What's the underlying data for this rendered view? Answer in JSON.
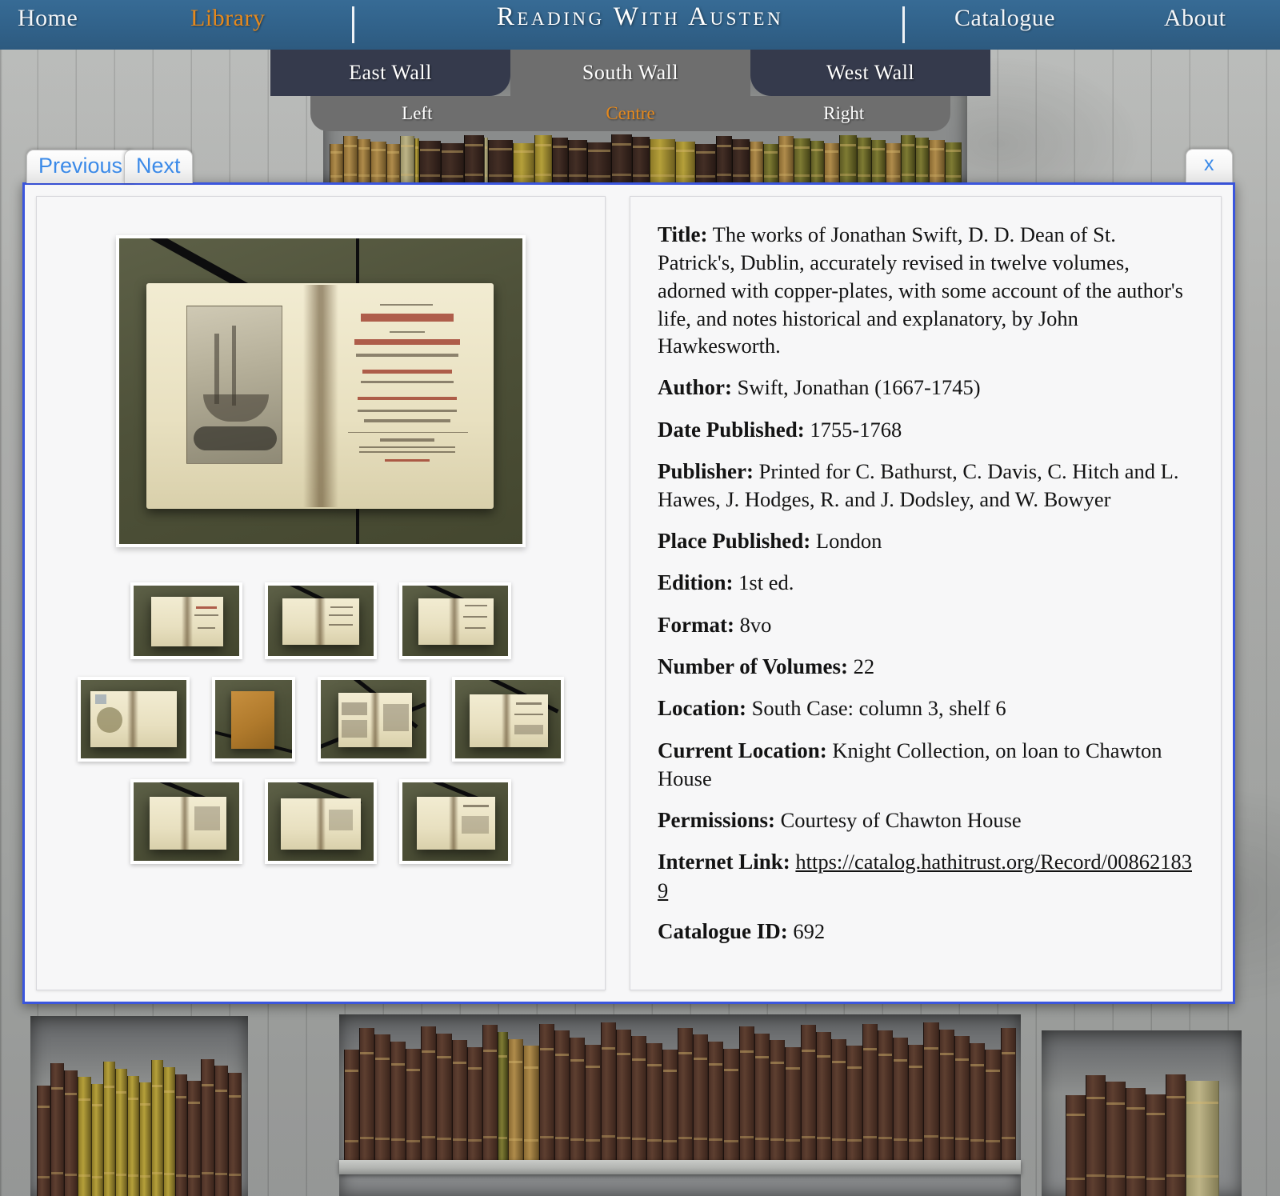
{
  "header": {
    "title": "Reading With Austen",
    "nav": [
      {
        "id": "home",
        "label": "Home",
        "active": false
      },
      {
        "id": "library",
        "label": "Library",
        "active": true
      },
      {
        "id": "catalogue",
        "label": "Catalogue",
        "active": false
      },
      {
        "id": "about",
        "label": "About",
        "active": false
      }
    ],
    "accent_color": "#e5891d",
    "bar_color": "#31628a"
  },
  "wall_tabs": [
    {
      "id": "east",
      "label": "East Wall",
      "active": false
    },
    {
      "id": "south",
      "label": "South Wall",
      "active": true
    },
    {
      "id": "west",
      "label": "West Wall",
      "active": false
    }
  ],
  "section_tabs": [
    {
      "id": "left",
      "label": "Left",
      "active": false
    },
    {
      "id": "centre",
      "label": "Centre",
      "active": true
    },
    {
      "id": "right",
      "label": "Right",
      "active": false
    }
  ],
  "modal": {
    "previous_label": "Previous",
    "next_label": "Next",
    "close_label": "x",
    "border_color": "#3b56dd"
  },
  "record": {
    "fields": [
      {
        "label": "Title:",
        "value": "The works of Jonathan Swift, D. D. Dean of St. Patrick's, Dublin, accurately revised in twelve volumes, adorned with copper-plates, with some account of the author's life, and notes historical and explanatory, by John Hawkesworth."
      },
      {
        "label": "Author:",
        "value": "Swift, Jonathan (1667-1745)"
      },
      {
        "label": "Date Published:",
        "value": "1755-1768"
      },
      {
        "label": "Publisher:",
        "value": "Printed for C. Bathurst, C. Davis, C. Hitch and L. Hawes, J. Hodges, R. and J. Dodsley, and W. Bowyer"
      },
      {
        "label": "Place Published:",
        "value": "London"
      },
      {
        "label": "Edition:",
        "value": "1st ed."
      },
      {
        "label": "Format:",
        "value": "8vo"
      },
      {
        "label": "Number of Volumes:",
        "value": "22"
      },
      {
        "label": "Location:",
        "value": "South Case: column 3, shelf 6"
      },
      {
        "label": "Current Location:",
        "value": "Knight Collection, on loan to Chawton House"
      },
      {
        "label": "Permissions:",
        "value": "Courtesy of Chawton House"
      },
      {
        "label": "Internet Link:",
        "value": "https://catalog.hathitrust.org/Record/008621839",
        "is_link": true
      },
      {
        "label": "Catalogue ID:",
        "value": "692"
      }
    ]
  },
  "media": {
    "main_image_alt": "Open book showing ship frontispiece engraving and red-and-black title page of The Works of Jonathan Swift",
    "thumbnail_rows": [
      [
        {
          "alt": "Open book, title page",
          "kind": "title"
        },
        {
          "alt": "Open book, text pages",
          "kind": "text"
        },
        {
          "alt": "Open book, text pages",
          "kind": "text"
        }
      ],
      [
        {
          "alt": "Open book with bookplate and armorial stamp",
          "kind": "plate"
        },
        {
          "alt": "Closed book, tan leather cover",
          "kind": "closed"
        },
        {
          "alt": "Open book, dense text pages",
          "kind": "dense"
        },
        {
          "alt": "Open book, heading page",
          "kind": "heading"
        }
      ],
      [
        {
          "alt": "Open book, text pages",
          "kind": "text"
        },
        {
          "alt": "Open book, text pages",
          "kind": "text"
        },
        {
          "alt": "Open book, text pages",
          "kind": "text"
        }
      ]
    ]
  }
}
